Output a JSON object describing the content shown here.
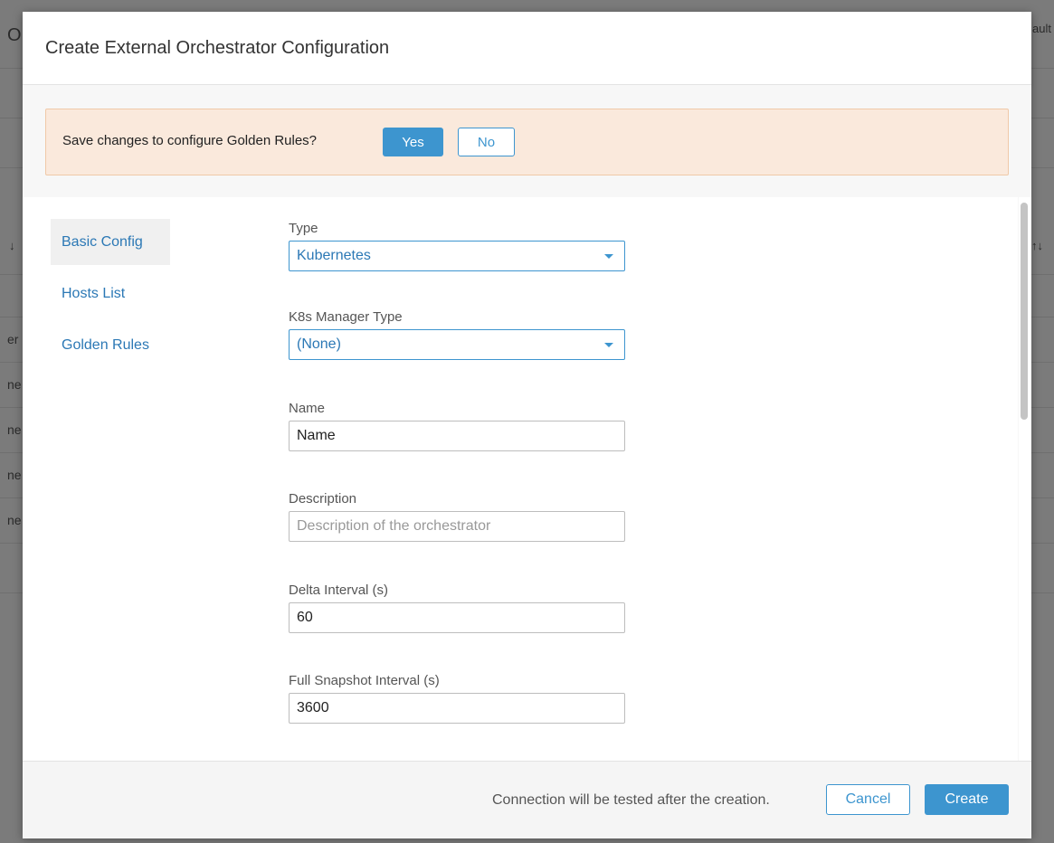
{
  "background": {
    "title_fragment": "O",
    "right_fragment": "ault",
    "sort_icon_left": "↓",
    "sort_icon_right": "↑↓",
    "row_fragments": [
      "er",
      "ne",
      "ne",
      "ne",
      "ne"
    ]
  },
  "modal": {
    "title": "Create External Orchestrator Configuration",
    "alert": {
      "text": "Save changes to configure Golden Rules?",
      "yes_label": "Yes",
      "no_label": "No"
    },
    "nav": {
      "items": [
        {
          "label": "Basic Config",
          "active": true
        },
        {
          "label": "Hosts List",
          "active": false
        },
        {
          "label": "Golden Rules",
          "active": false
        }
      ]
    },
    "form": {
      "type": {
        "label": "Type",
        "value": "Kubernetes"
      },
      "k8s_manager_type": {
        "label": "K8s Manager Type",
        "value": "(None)"
      },
      "name": {
        "label": "Name",
        "value": "Name",
        "placeholder": ""
      },
      "description": {
        "label": "Description",
        "value": "",
        "placeholder": "Description of the orchestrator"
      },
      "delta_interval": {
        "label": "Delta Interval (s)",
        "value": "60"
      },
      "full_snapshot_interval": {
        "label": "Full Snapshot Interval (s)",
        "value": "3600"
      }
    },
    "footer": {
      "note": "Connection will be tested after the creation.",
      "cancel_label": "Cancel",
      "create_label": "Create"
    }
  },
  "colors": {
    "accent": "#3d95cf",
    "link": "#2b78b5",
    "alert_bg": "#fae9dc",
    "overlay": "#7b7b7b"
  }
}
